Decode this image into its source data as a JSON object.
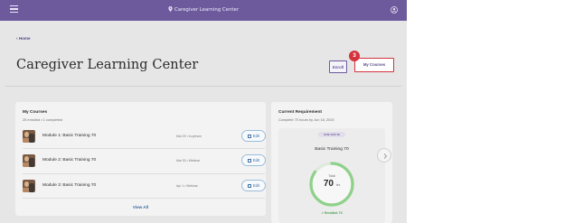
{
  "app": {
    "title": "Caregiver Learning Center"
  },
  "nav": {
    "back_label": "Home"
  },
  "header": {
    "page_title": "Caregiver Learning Center",
    "enroll_label": "Enroll",
    "my_courses_label": "My Courses",
    "step_badge": "3"
  },
  "courses": {
    "title": "My Courses",
    "summary": "25 enrolled • 1 completed",
    "items": [
      {
        "name": "Module 1: Basic Training 70",
        "meta": "Mar 29 • In-person",
        "edit_label": "Edit"
      },
      {
        "name": "Module 2: Basic Training 70",
        "meta": "Mar 30 • Webinar",
        "edit_label": "Edit"
      },
      {
        "name": "Module 3: Basic Training 70",
        "meta": "Apr 1 • Webinar",
        "edit_label": "Edit"
      }
    ],
    "view_all_label": "View All"
  },
  "requirement": {
    "title": "Current Requirement",
    "subtitle": "Complete 70 hours by Jun 18, 2020",
    "date_pill": "DUE JUN 18",
    "card_title": "Basic Training 70",
    "ring_label": "Total",
    "ring_value": "70",
    "ring_unit": "hrs",
    "enrolled_text": "✓ Enrolled: 70",
    "ring_progress": 0.85
  },
  "colors": {
    "brand": "#6c5a9c",
    "highlight": "#d4333d",
    "ring": "#8fd18a",
    "link": "#3f6ea1"
  },
  "icons": [
    "menu-icon",
    "location-pin-icon",
    "user-icon",
    "chevron-left-icon",
    "calendar-icon",
    "chevron-right-icon"
  ]
}
